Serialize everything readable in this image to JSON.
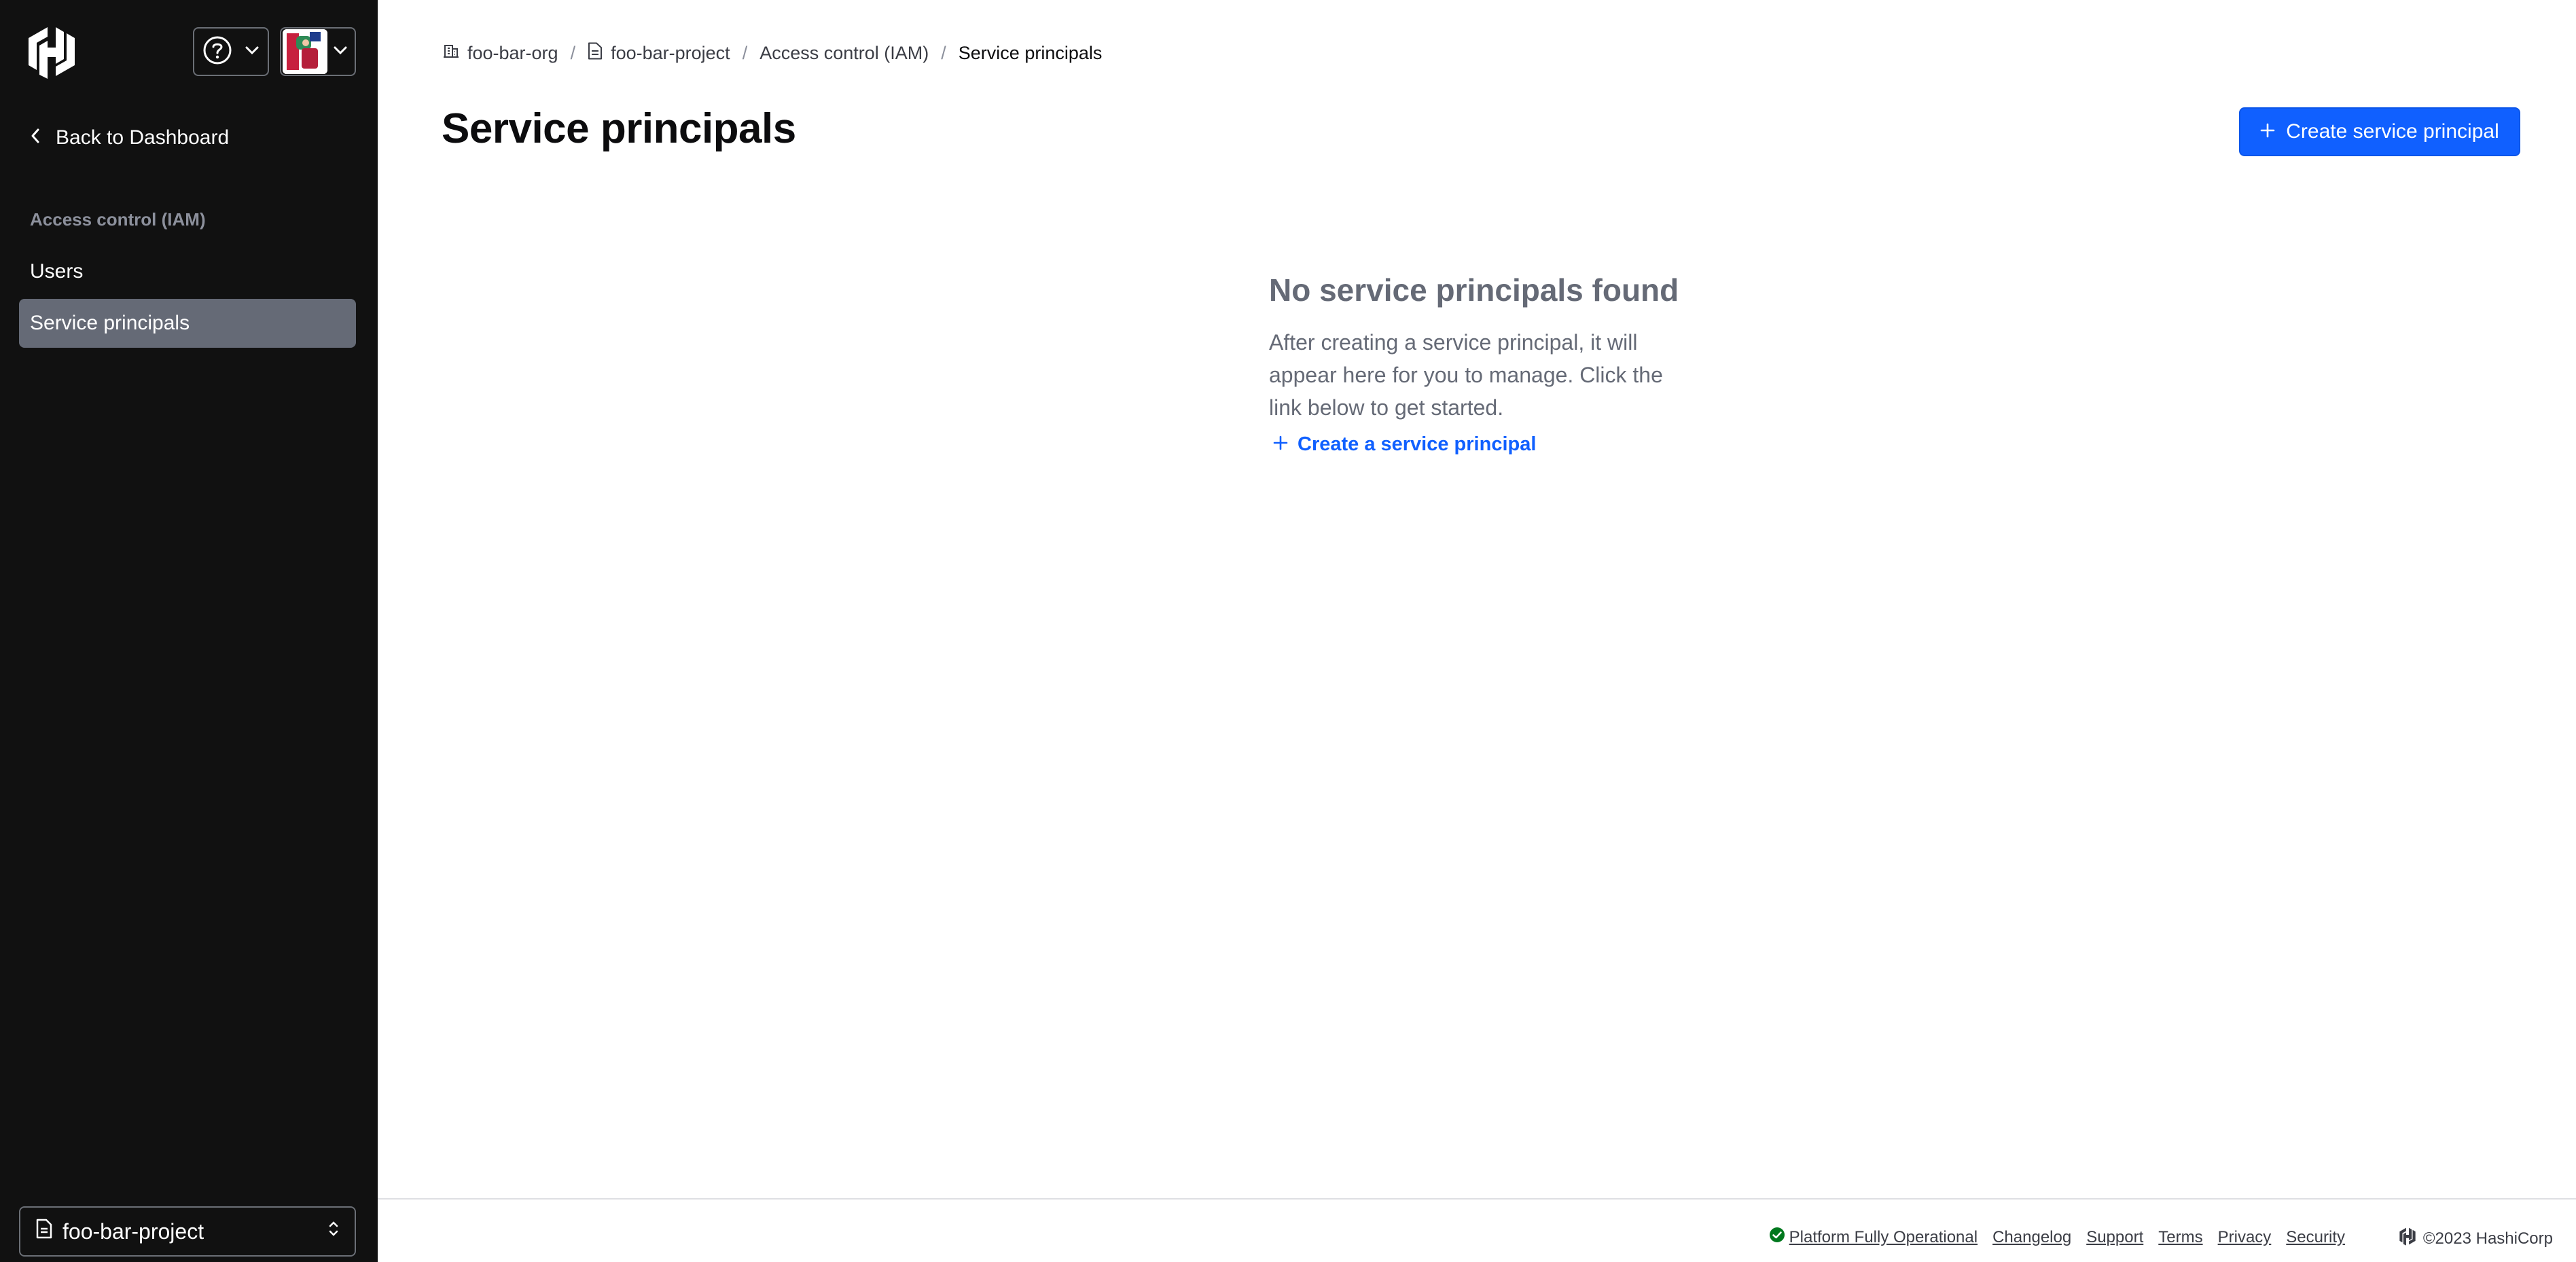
{
  "sidebar": {
    "back_label": "Back to Dashboard",
    "section_label": "Access control (IAM)",
    "items": [
      {
        "label": "Users"
      },
      {
        "label": "Service principals"
      }
    ],
    "project_name": "foo-bar-project"
  },
  "breadcrumb": [
    {
      "label": "foo-bar-org",
      "icon": "building-icon"
    },
    {
      "label": "foo-bar-project",
      "icon": "file-icon"
    },
    {
      "label": "Access control (IAM)"
    },
    {
      "label": "Service principals"
    }
  ],
  "page": {
    "title": "Service principals",
    "primary_action": "Create service principal"
  },
  "empty_state": {
    "title": "No service principals found",
    "body": "After creating a service principal, it will appear here for you to manage. Click the link below to get started.",
    "link": "Create a service principal"
  },
  "footer": {
    "status": "Platform Fully Operational",
    "links": [
      "Changelog",
      "Support",
      "Terms",
      "Privacy",
      "Security"
    ],
    "copyright": "©2023 HashiCorp"
  },
  "colors": {
    "sidebar_bg": "#111111",
    "active_item": "#656a76",
    "primary": "#1060ff",
    "status_ok": "#00781e"
  }
}
